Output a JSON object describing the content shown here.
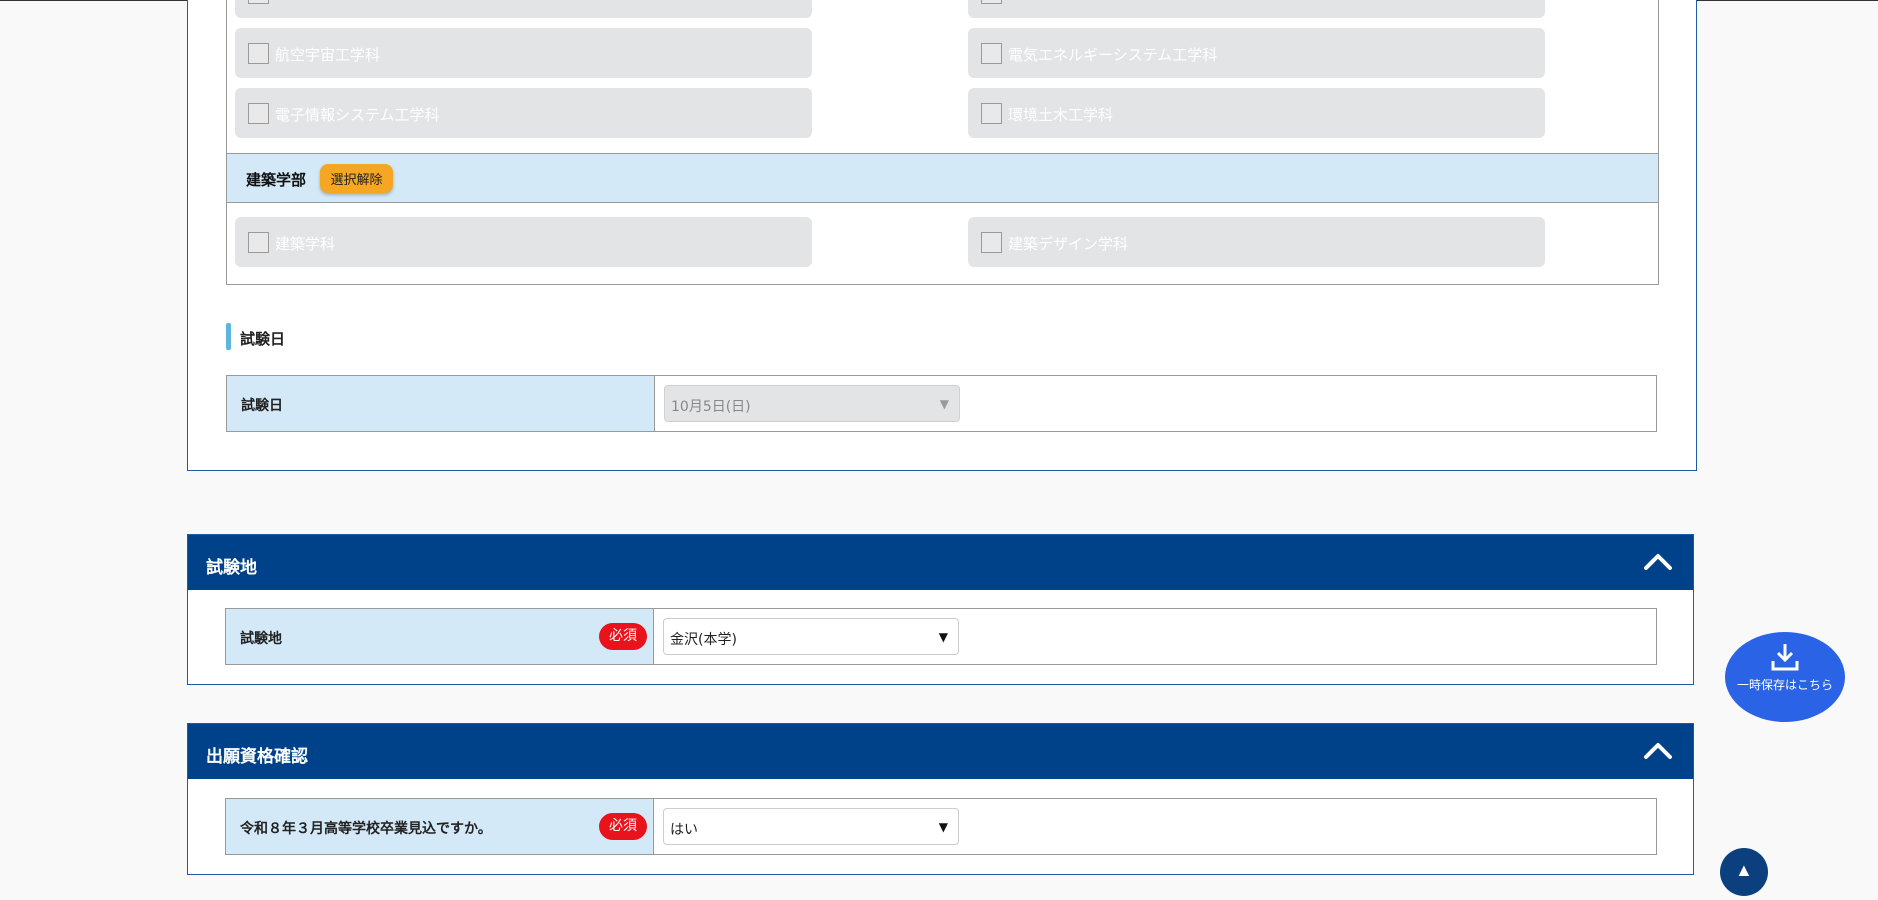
{
  "departments_top": [
    {
      "label": "航空宇宙工学科"
    },
    {
      "label": "電気エネルギーシステム工学科"
    },
    {
      "label": "電子情報システム工学科"
    },
    {
      "label": "環境土木工学科"
    }
  ],
  "architecture_faculty": {
    "name": "建築学部",
    "clear_label": "選択解除",
    "departments": [
      {
        "label": "建築学科"
      },
      {
        "label": "建築デザイン学科"
      }
    ]
  },
  "exam_date_section": {
    "heading": "試験日",
    "row_label": "試験日",
    "select_value": "10月5日(日)"
  },
  "exam_location_panel": {
    "title": "試験地",
    "row_label": "試験地",
    "required_label": "必須",
    "select_value": "金沢(本学)"
  },
  "eligibility_panel": {
    "title": "出願資格確認",
    "row_label": "令和８年３月高等学校卒業見込ですか。",
    "required_label": "必須",
    "select_value": "はい"
  },
  "save_button": {
    "label": "一時保存はこちら"
  },
  "colors": {
    "panel_header": "#004289",
    "label_cell": "#d3e9f7",
    "required_badge": "#e8131b",
    "clear_button": "#f5a623",
    "save_button": "#2a63e6"
  }
}
